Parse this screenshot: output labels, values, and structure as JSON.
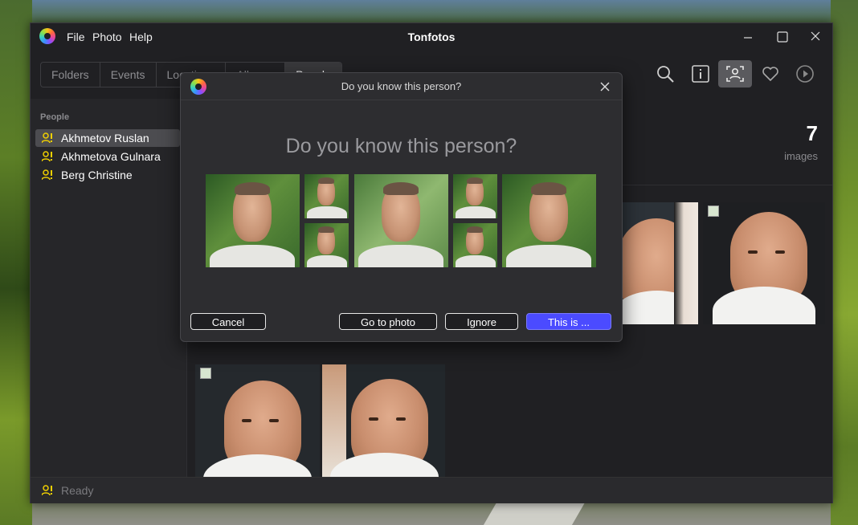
{
  "app": {
    "title": "Tonfotos",
    "menu": [
      "File",
      "Photo",
      "Help"
    ]
  },
  "tabs": [
    {
      "label": "Folders",
      "active": false
    },
    {
      "label": "Events",
      "active": false
    },
    {
      "label": "Locations",
      "active": false
    },
    {
      "label": "Albums",
      "active": false
    },
    {
      "label": "People",
      "active": true
    }
  ],
  "toolbar": {
    "icons": [
      "search-icon",
      "info-icon",
      "people-icon",
      "heart-icon",
      "play-icon"
    ],
    "active": "people-icon"
  },
  "sidebar": {
    "heading": "People",
    "items": [
      {
        "label": "Akhmetov Ruslan",
        "selected": true
      },
      {
        "label": "Akhmetova Gulnara",
        "selected": false
      },
      {
        "label": "Berg Christine",
        "selected": false
      }
    ]
  },
  "main": {
    "count": "7",
    "count_label": "images"
  },
  "status": {
    "text": "Ready"
  },
  "dialog": {
    "title": "Do you know this person?",
    "question": "Do you know this person?",
    "buttons": {
      "cancel": "Cancel",
      "go_to_photo": "Go to photo",
      "ignore": "Ignore",
      "this_is": "This is ..."
    }
  },
  "colors": {
    "accent": "#4b4bff",
    "person_icon": "#f0d000",
    "window_bg": "#202023"
  }
}
